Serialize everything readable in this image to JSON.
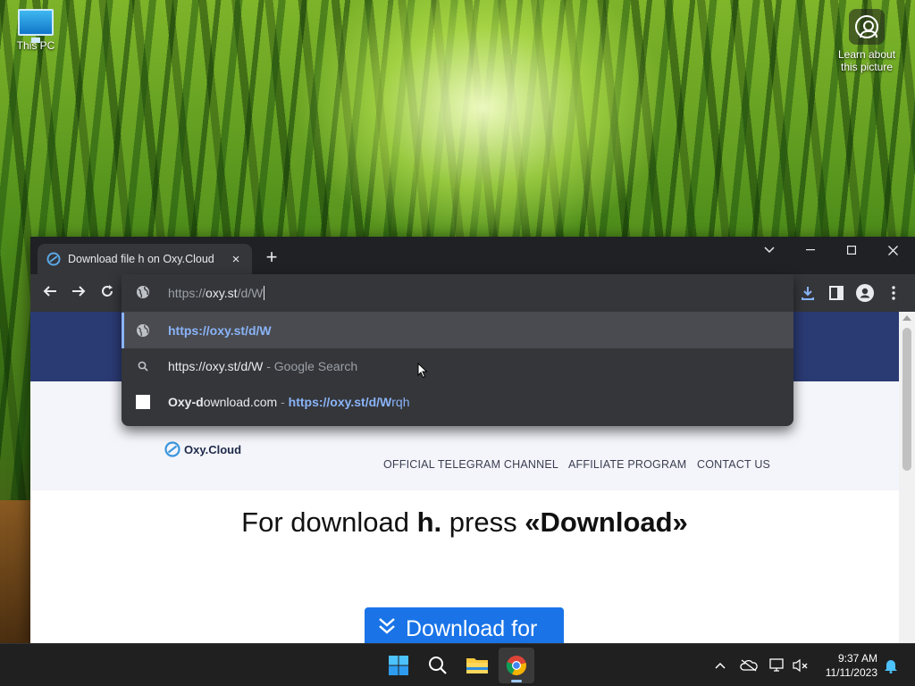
{
  "desktop": {
    "icons": [
      {
        "label": "This PC",
        "icon": "computer-icon"
      }
    ],
    "learn_label_line1": "Learn about",
    "learn_label_line2": "this picture"
  },
  "browser": {
    "tab": {
      "title": "Download file h on Oxy.Cloud",
      "close": "×"
    },
    "new_tab": "+",
    "window_controls": {
      "dropdown": "tab-search-chevron",
      "minimize": "minimize",
      "maximize": "maximize",
      "close": "close"
    },
    "omnibox": {
      "prefix": "https://",
      "typed": "oxy.st",
      "suffix": "/d/W",
      "suggestions": [
        {
          "icon": "globe-icon",
          "text": "https://oxy.st/d/W",
          "selected": true
        },
        {
          "icon": "search-icon",
          "text": "https://oxy.st/d/W",
          "source": "- Google Search"
        },
        {
          "icon": "favicon-blank-icon",
          "site_bold_1": "Oxy-d",
          "site_rest": "ownload.com",
          "separator": "-",
          "url_bold": "https://oxy.st/d/W",
          "url_rest": "rqh"
        }
      ]
    }
  },
  "page": {
    "logo_text": "Oxy.Cloud",
    "nav": [
      "OFFICIAL TELEGRAM CHANNEL",
      "AFFILIATE PROGRAM",
      "CONTACT US"
    ],
    "headline_pre": "For download ",
    "headline_file": "h.",
    "headline_mid": " press ",
    "headline_cta": "«Download»",
    "download_button": "Download for"
  },
  "taskbar": {
    "apps": [
      "windows-start-icon",
      "search-icon",
      "file-explorer-icon",
      "chrome-icon"
    ],
    "time": "9:37 AM",
    "date": "11/11/2023"
  },
  "colors": {
    "accent": "#1a74e8",
    "link": "#8ab4f8",
    "hero": "#2a3a73"
  }
}
